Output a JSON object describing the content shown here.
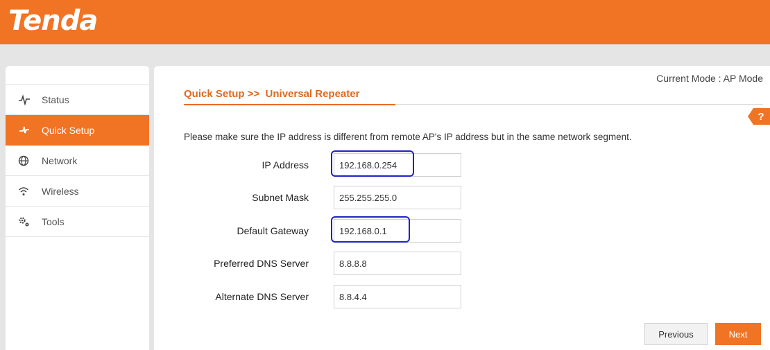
{
  "brand": {
    "logo_text": "Tenda",
    "accent": "#f07424",
    "highlight": "#1f23c8"
  },
  "sidebar": {
    "items": [
      {
        "label": "Status",
        "icon": "pulse-icon",
        "active": false
      },
      {
        "label": "Quick Setup",
        "icon": "lightning-icon",
        "active": true
      },
      {
        "label": "Network",
        "icon": "globe-icon",
        "active": false
      },
      {
        "label": "Wireless",
        "icon": "wifi-icon",
        "active": false
      },
      {
        "label": "Tools",
        "icon": "gears-icon",
        "active": false
      }
    ]
  },
  "main": {
    "mode_text": "Current Mode : AP Mode",
    "breadcrumb": "Quick Setup >>  Universal Repeater",
    "help_label": "?",
    "note": "Please make sure the IP address is different from remote AP's IP address but in the same network segment.",
    "fields": [
      {
        "label": "IP Address",
        "value": "192.168.0.254",
        "highlighted": true
      },
      {
        "label": "Subnet Mask",
        "value": "255.255.255.0",
        "highlighted": false
      },
      {
        "label": "Default Gateway",
        "value": "192.168.0.1",
        "highlighted": true
      },
      {
        "label": "Preferred DNS Server",
        "value": "8.8.8.8",
        "highlighted": false
      },
      {
        "label": "Alternate DNS Server",
        "value": "8.8.4.4",
        "highlighted": false
      }
    ],
    "buttons": {
      "previous": "Previous",
      "next": "Next"
    }
  }
}
